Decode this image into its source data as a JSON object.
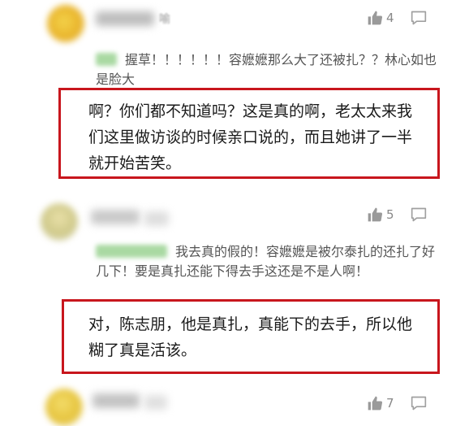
{
  "comments": [
    {
      "name_suffix": "喻",
      "likes": "4",
      "quote": "握草！！！！！！容嬷嬷那么大了还被扎？？林心如也是脸大",
      "reply": "啊？你们都不知道吗？这是真的啊，老太太来我们这里做访谈的时候亲口说的，而且她讲了一半就开始苦笑。"
    },
    {
      "likes": "5",
      "quote": "我去真的假的！容嬷嬷是被尔泰扎的还扎了好几下！要是真扎还能下得去手这还是不是人啊！",
      "reply": "对，陈志朋，他是真扎，真能下的去手，所以他糊了真是活该。"
    },
    {
      "likes": "7"
    }
  ],
  "colors": {
    "highlight_border": "#c8161d",
    "quote_name_green": "#a9d9a2"
  },
  "icons": [
    "thumbs-up-icon",
    "comment-bubble-icon"
  ]
}
